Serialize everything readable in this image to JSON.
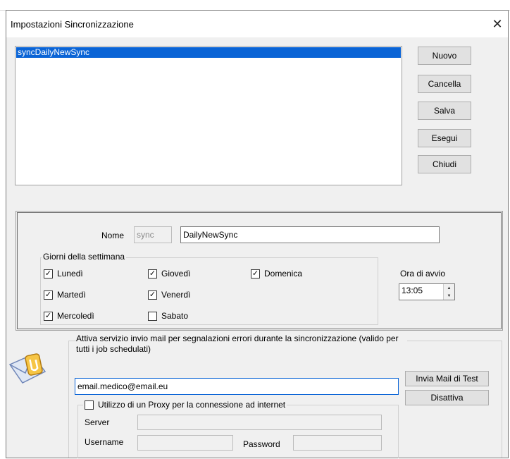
{
  "window": {
    "title": "Impostazioni Sincronizzazione",
    "close_glyph": "✕"
  },
  "list": {
    "items": [
      "syncDailyNewSync"
    ]
  },
  "side_buttons": {
    "new": "Nuovo",
    "delete": "Cancella",
    "save": "Salva",
    "run": "Esegui",
    "close": "Chiudi"
  },
  "form": {
    "name_label": "Nome",
    "prefix": "sync",
    "name_value": "DailyNewSync",
    "days_group": "Giorni della settimana",
    "days": [
      {
        "label": "Lunedì",
        "checked": true
      },
      {
        "label": "Martedì",
        "checked": true
      },
      {
        "label": "Mercoledì",
        "checked": true
      },
      {
        "label": "Giovedì",
        "checked": true
      },
      {
        "label": "Venerdì",
        "checked": true
      },
      {
        "label": "Sabato",
        "checked": false
      },
      {
        "label": "Domenica",
        "checked": true
      }
    ],
    "start_time_label": "Ora di avvio",
    "start_time": "13:05"
  },
  "mail": {
    "group_label": "Attiva servizio invio mail per segnalazioni errori durante la sincronizzazione (valido per tutti i job schedulati)",
    "email": "email.medico@email.eu",
    "test_button": "Invia Mail di Test",
    "disable_button": "Disattiva",
    "proxy_label": "Utilizzo di un Proxy per la connessione ad internet",
    "proxy_checked": false,
    "server_label": "Server",
    "server_value": "",
    "username_label": "Username",
    "username_value": "",
    "password_label": "Password",
    "password_value": ""
  },
  "icons": {
    "mail": "mail-envelope-icon"
  },
  "colors": {
    "selection": "#0a64d6",
    "window_bg": "#f0f0f0"
  }
}
